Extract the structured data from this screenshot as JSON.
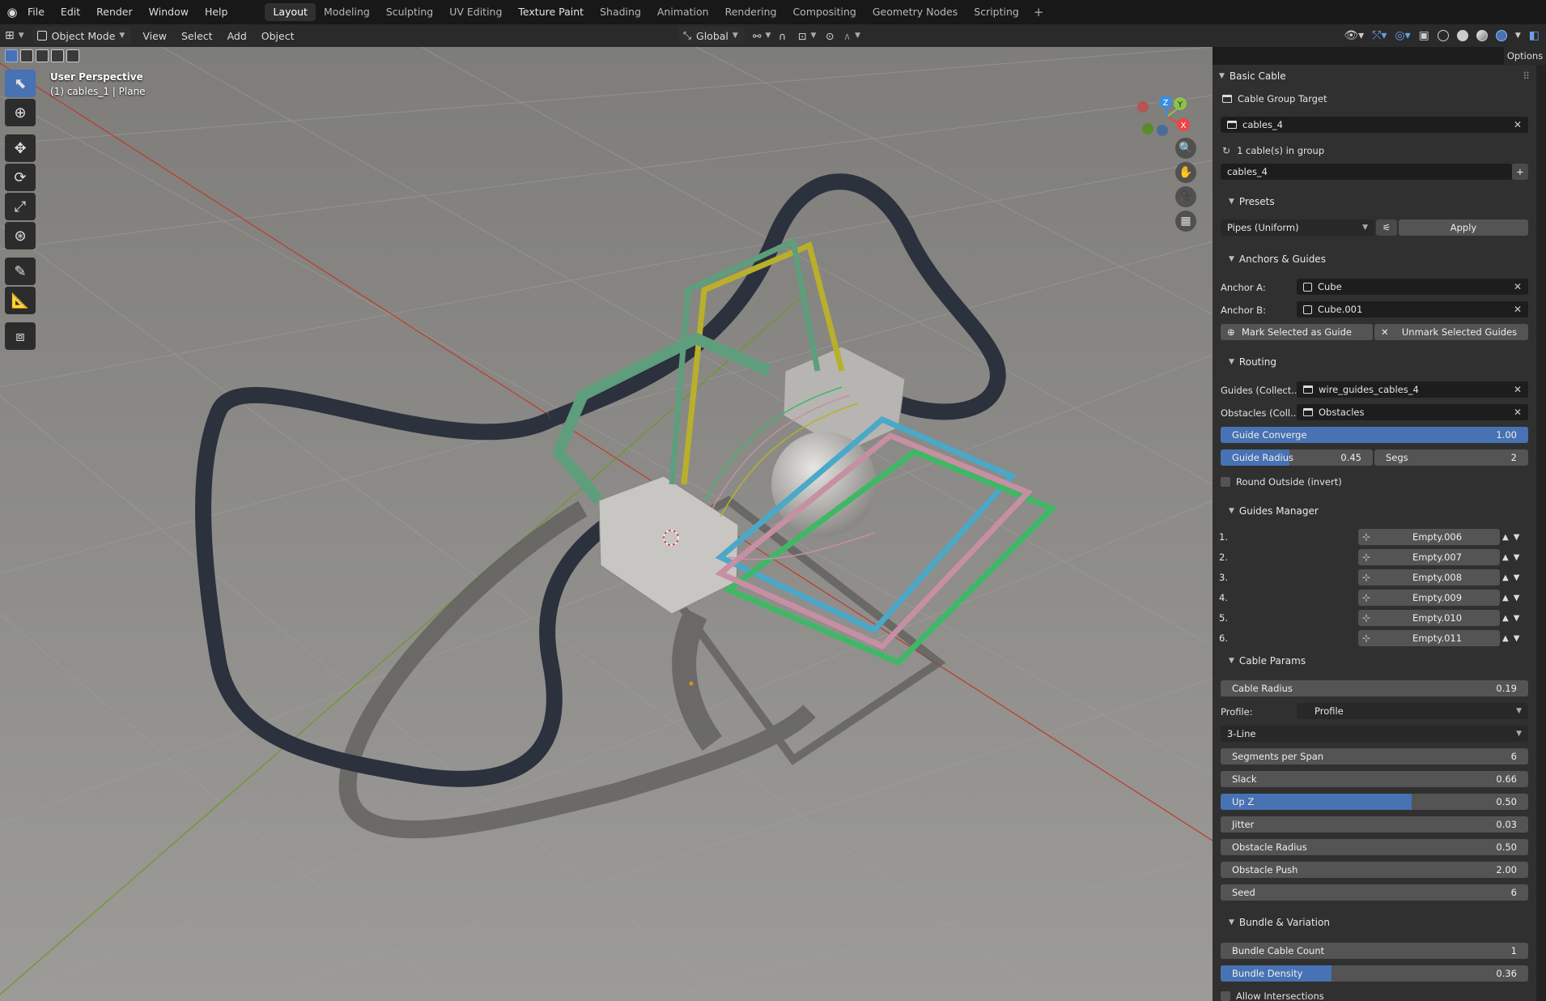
{
  "topbar": {
    "menus": [
      "File",
      "Edit",
      "Render",
      "Window",
      "Help"
    ],
    "workspaces": [
      "Layout",
      "Modeling",
      "Sculpting",
      "UV Editing",
      "Texture Paint",
      "Shading",
      "Animation",
      "Rendering",
      "Compositing",
      "Geometry Nodes",
      "Scripting"
    ],
    "active_workspace": "Layout",
    "add_tab": "+"
  },
  "header": {
    "mode": "Object Mode",
    "menus": [
      "View",
      "Select",
      "Add",
      "Object"
    ],
    "transform_orientation": "Global",
    "options": "Options"
  },
  "viewport": {
    "perspective": "User Perspective",
    "object_info": "(1) cables_1 | Plane",
    "gizmo_axes": {
      "x": "X",
      "y": "Y",
      "z": "Z"
    },
    "colors": {
      "floor": "#8e8d8a",
      "x_axis": "#c0392b",
      "y_axis": "#6b9a1f"
    }
  },
  "panel": {
    "title": "Basic Cable",
    "cable_group_target_label": "Cable Group Target",
    "cable_group_target": "cables_4",
    "group_count": "1 cable(s) in group",
    "group_name": "cables_4",
    "presets": {
      "header": "Presets",
      "value": "Pipes (Uniform)",
      "apply": "Apply"
    },
    "anchors": {
      "header": "Anchors & Guides",
      "anchor_a_label": "Anchor A:",
      "anchor_a": "Cube",
      "anchor_b_label": "Anchor B:",
      "anchor_b": "Cube.001",
      "mark_guide": "Mark Selected as Guide",
      "unmark_guide": "Unmark Selected Guides"
    },
    "routing": {
      "header": "Routing",
      "guides_label": "Guides (Collect...",
      "guides_value": "wire_guides_cables_4",
      "obstacles_label": "Obstacles (Coll...",
      "obstacles_value": "Obstacles",
      "guide_converge_label": "Guide Converge",
      "guide_converge": "1.00",
      "guide_converge_fraction": 1.0,
      "guide_radius_label": "Guide Radius",
      "guide_radius": "0.45",
      "guide_radius_fraction": 0.45,
      "segs_label": "Segs",
      "segs": "2",
      "round_outside": "Round Outside (invert)"
    },
    "guides_manager": {
      "header": "Guides Manager",
      "items": [
        {
          "num": "1.",
          "name": "Empty.006"
        },
        {
          "num": "2.",
          "name": "Empty.007"
        },
        {
          "num": "3.",
          "name": "Empty.008"
        },
        {
          "num": "4.",
          "name": "Empty.009"
        },
        {
          "num": "5.",
          "name": "Empty.010"
        },
        {
          "num": "6.",
          "name": "Empty.011"
        }
      ]
    },
    "cable_params": {
      "header": "Cable Params",
      "cable_radius_label": "Cable Radius",
      "cable_radius": "0.19",
      "profile_label": "Profile:",
      "profile_value": "Profile",
      "profile_type": "3-Line",
      "segments_label": "Segments per Span",
      "segments": "6",
      "slack_label": "Slack",
      "slack": "0.66",
      "upz_label": "Up Z",
      "upz": "0.50",
      "upz_fraction": 0.62,
      "jitter_label": "Jitter",
      "jitter": "0.03",
      "obstacle_radius_label": "Obstacle Radius",
      "obstacle_radius": "0.50",
      "obstacle_push_label": "Obstacle Push",
      "obstacle_push": "2.00",
      "seed_label": "Seed",
      "seed": "6"
    },
    "bundle": {
      "header": "Bundle & Variation",
      "bundle_count_label": "Bundle Cable Count",
      "bundle_count": "1",
      "bundle_density_label": "Bundle Density",
      "bundle_density": "0.36",
      "bundle_density_fraction": 0.36,
      "allow_intersections": "Allow Intersections"
    }
  }
}
